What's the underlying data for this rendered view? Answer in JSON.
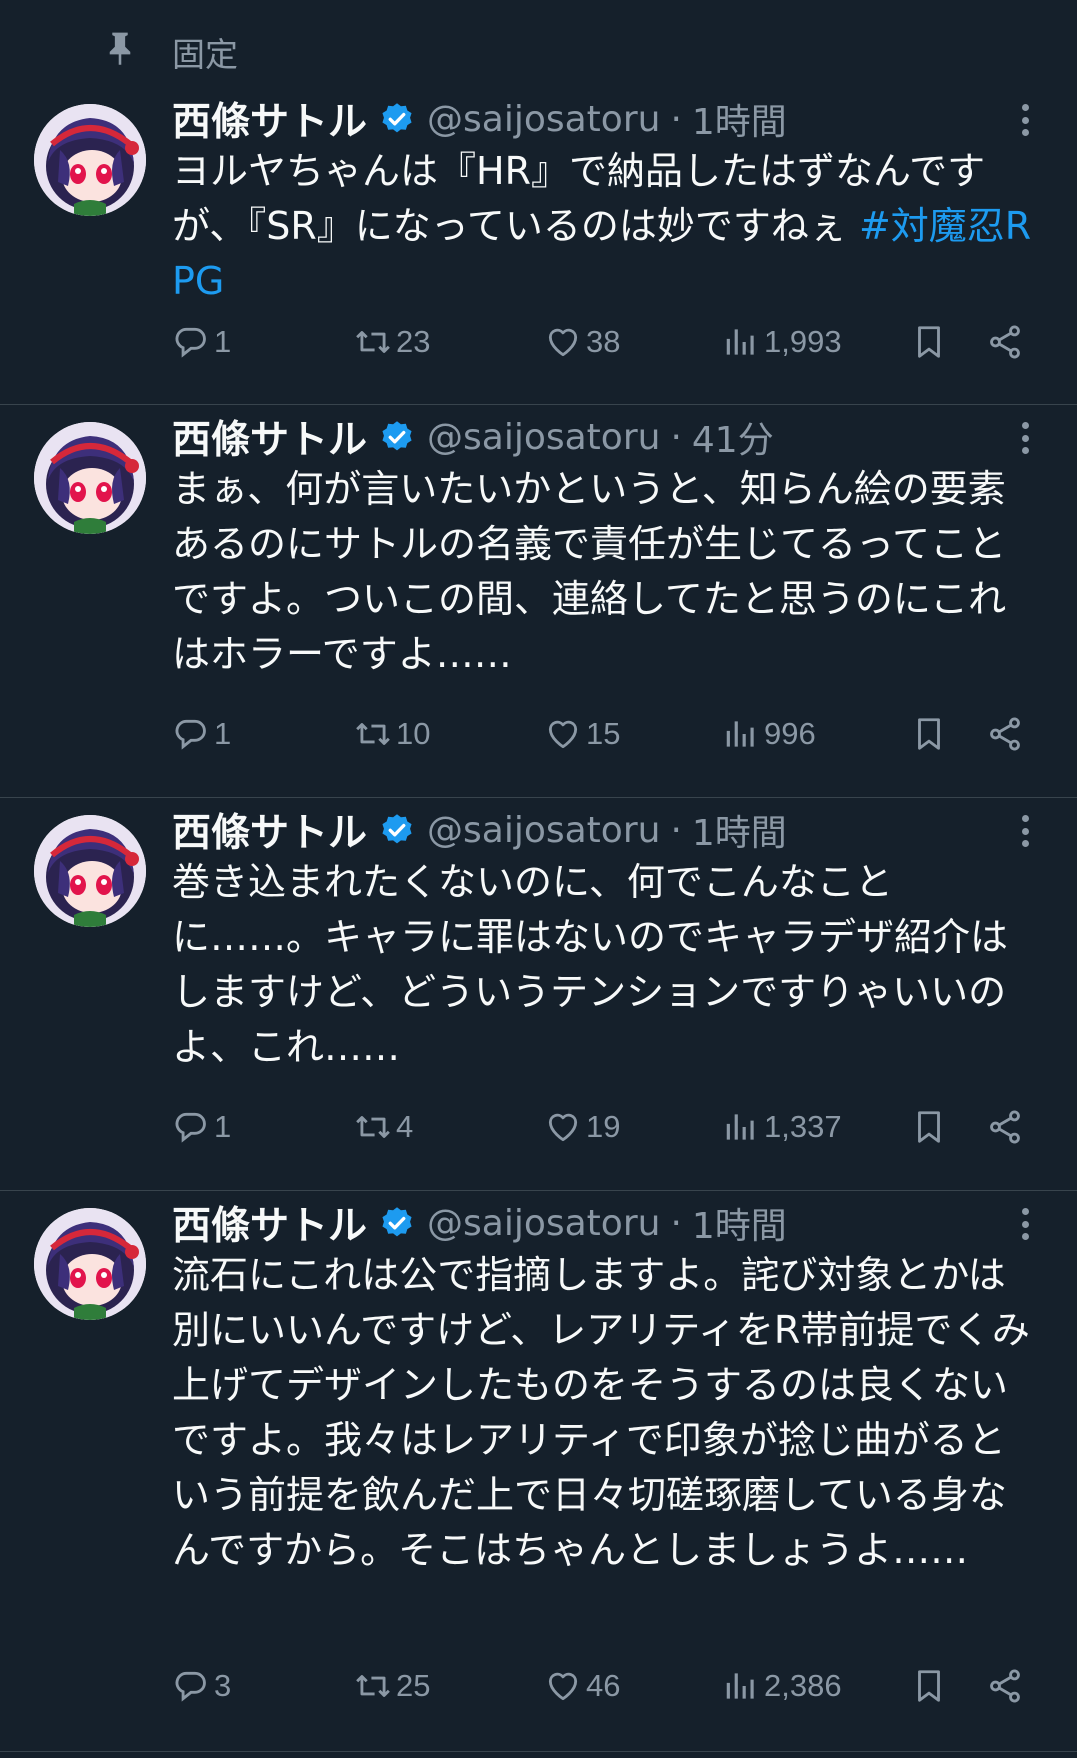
{
  "pinned": {
    "label": "固定",
    "icon": "pin-icon"
  },
  "user": {
    "name": "西條サトル",
    "handle": "@saijosatoru",
    "verified_color": "#1d9bf0"
  },
  "colors": {
    "background": "#15202b",
    "text": "#f7f9f9",
    "muted": "#8b98a5",
    "link": "#1d9bf0",
    "divider": "#38444d"
  },
  "tweets": [
    {
      "time": "1時間",
      "text": "ヨルヤちゃんは『HR』で納品したはずなんですが、『SR』になっているのは妙ですねぇ ",
      "hashtag": "#対魔忍RPG",
      "replies": "1",
      "retweets": "23",
      "likes": "38",
      "views": "1,993"
    },
    {
      "time": "41分",
      "text": "まぁ、何が言いたいかというと、知らん絵の要素あるのにサトルの名義で責任が生じてるってことですよ。ついこの間、連絡してたと思うのにこれはホラーですよ……",
      "hashtag": "",
      "replies": "1",
      "retweets": "10",
      "likes": "15",
      "views": "996"
    },
    {
      "time": "1時間",
      "text": "巻き込まれたくないのに、何でこんなことに……。キャラに罪はないのでキャラデザ紹介はしますけど、どういうテンションですりゃいいのよ、これ……",
      "hashtag": "",
      "replies": "1",
      "retweets": "4",
      "likes": "19",
      "views": "1,337"
    },
    {
      "time": "1時間",
      "text": "流石にこれは公で指摘しますよ。詫び対象とかは別にいいんですけど、レアリティをR帯前提でくみ上げてデザインしたものをそうするのは良くないですよ。我々はレアリティで印象が捻じ曲がるという前提を飲んだ上で日々切磋琢磨している身なんですから。そこはちゃんとしましょうよ……",
      "hashtag": "",
      "replies": "3",
      "retweets": "25",
      "likes": "46",
      "views": "2,386"
    }
  ],
  "icons": {
    "reply": "reply-icon",
    "retweet": "retweet-icon",
    "like": "heart-icon",
    "views": "views-icon",
    "bookmark": "bookmark-icon",
    "share": "share-icon",
    "more": "more-icon"
  }
}
